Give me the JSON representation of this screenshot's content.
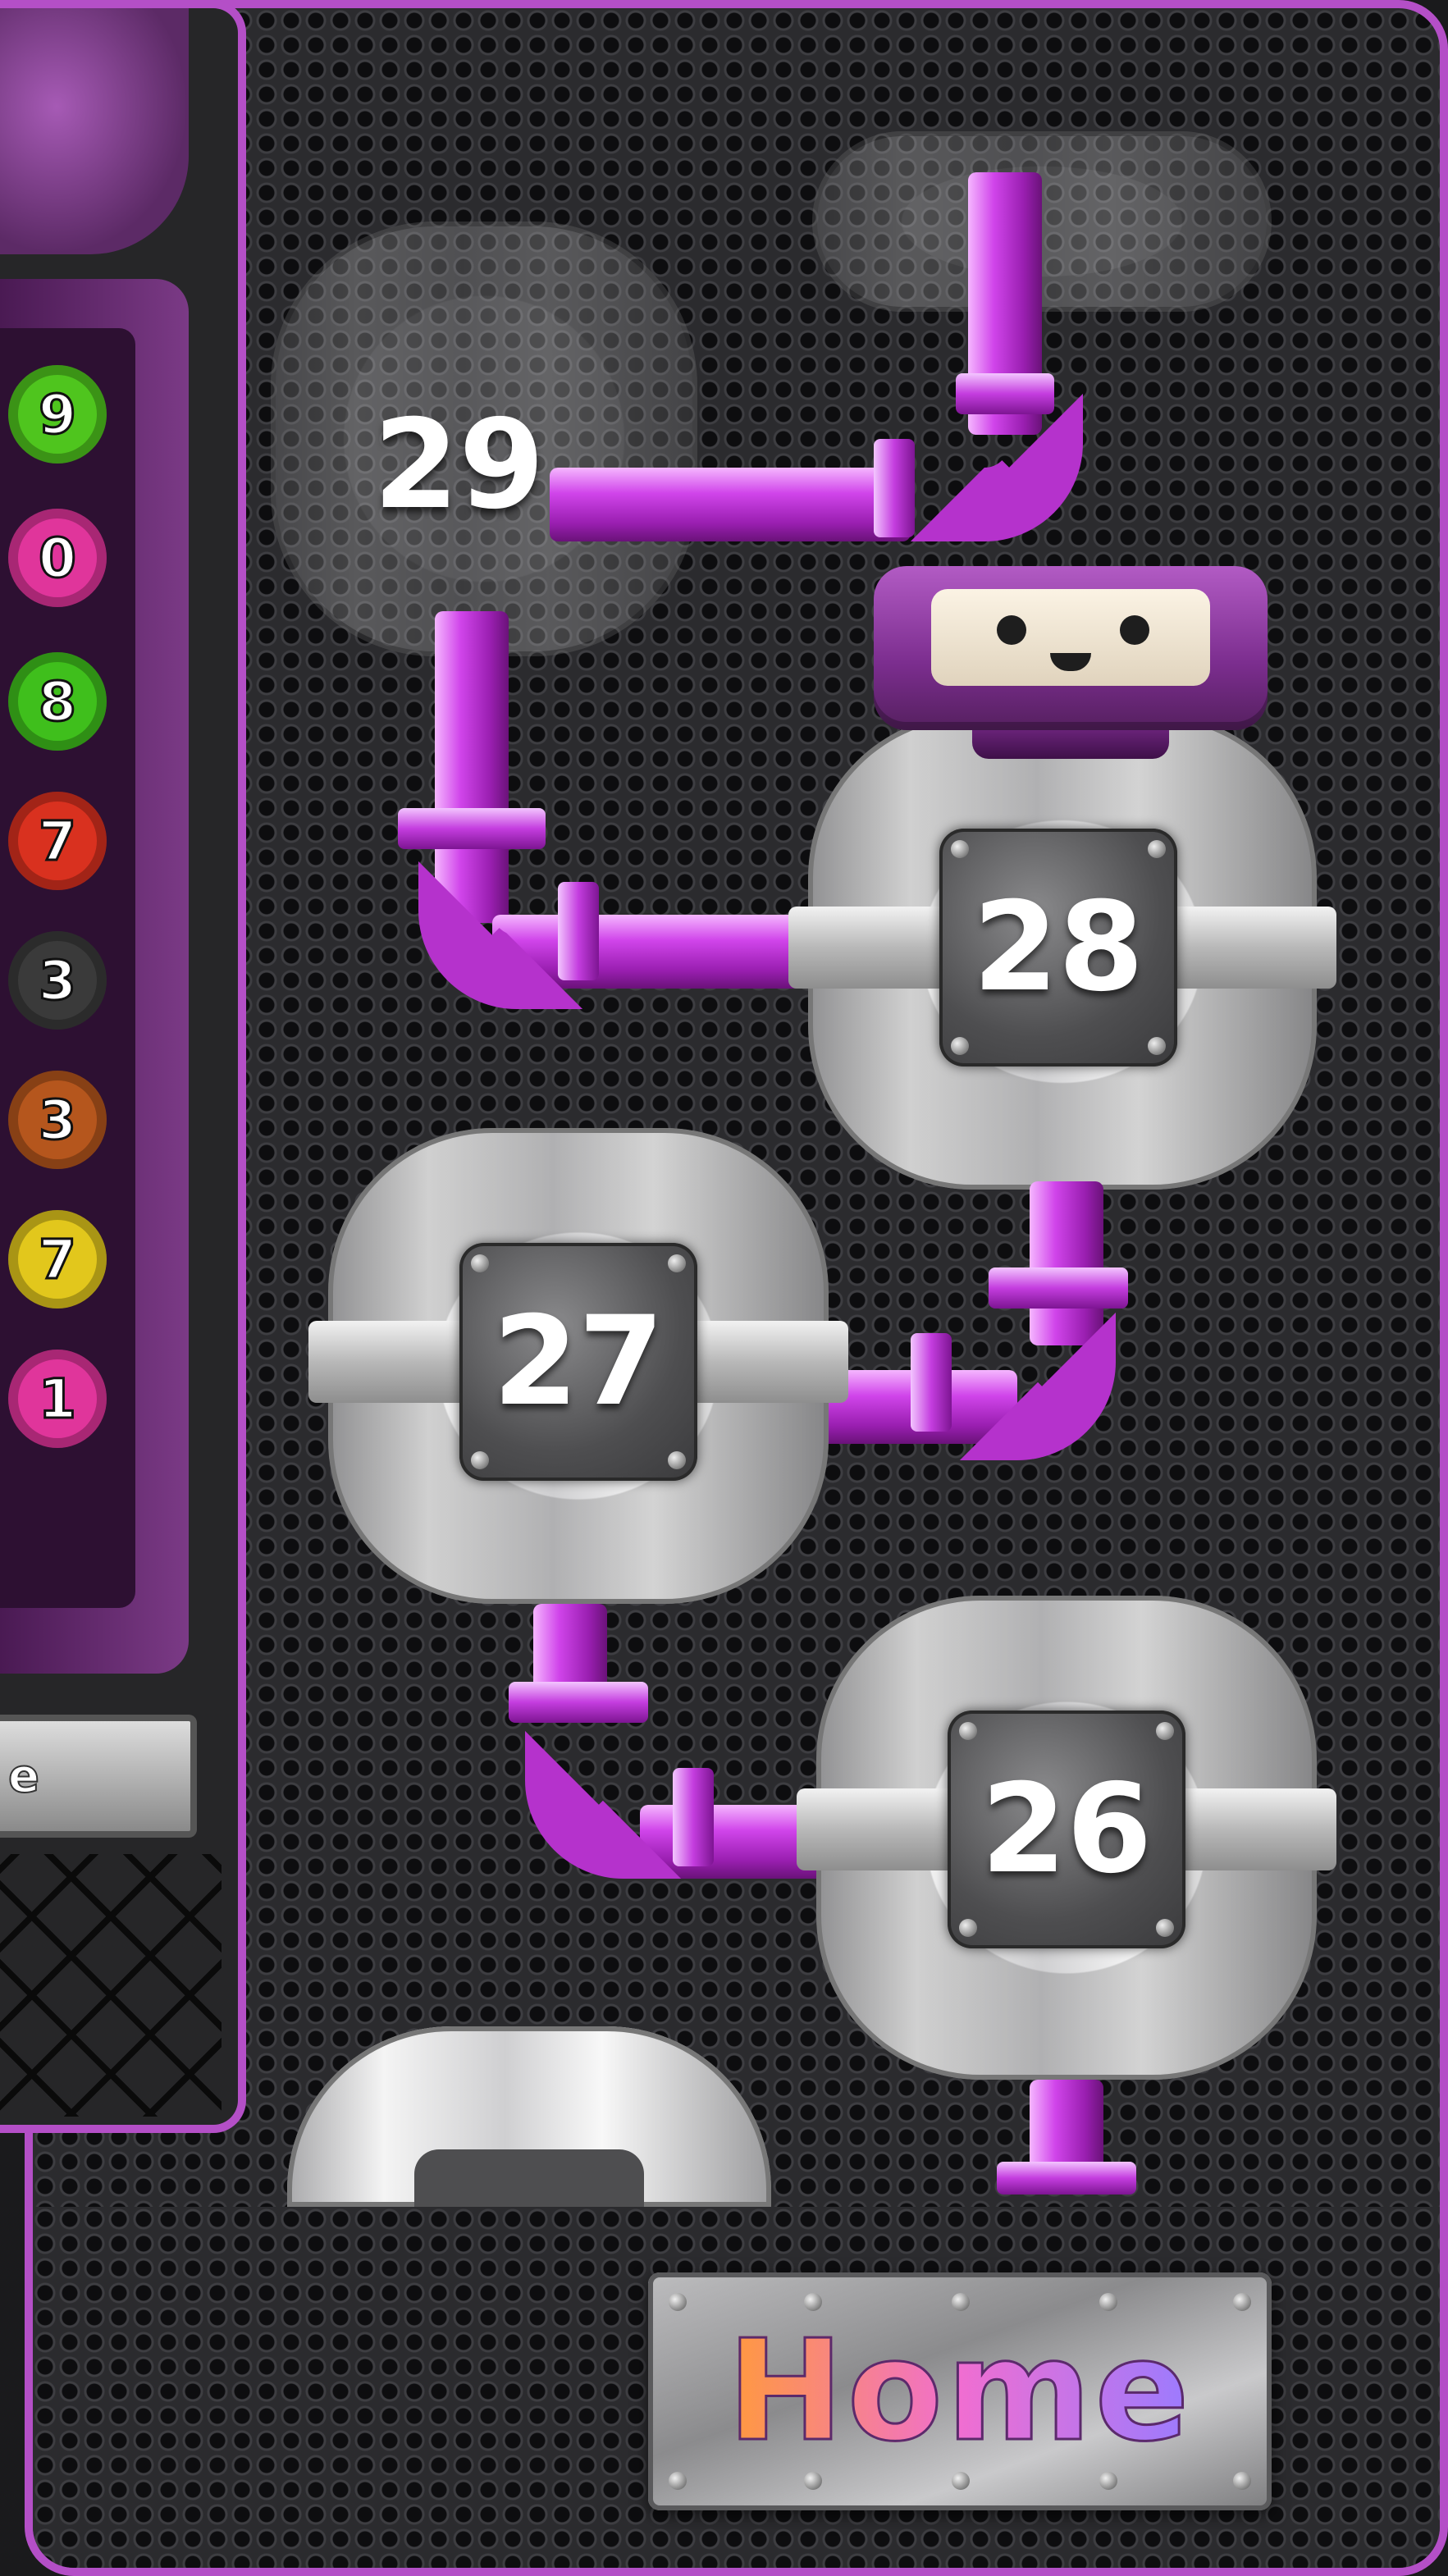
{
  "side_panel": {
    "gears": [
      {
        "label": "9",
        "color": "#4fc51e"
      },
      {
        "label": "0",
        "color": "#e0359b"
      },
      {
        "label": "8",
        "color": "#3fbf1c"
      },
      {
        "label": "7",
        "color": "#d9311f"
      },
      {
        "label": "3",
        "color": "#3a3a3a"
      },
      {
        "label": "3",
        "color": "#b5561d"
      },
      {
        "label": "7",
        "color": "#e2c71c"
      },
      {
        "label": "1",
        "color": "#e0359b"
      }
    ],
    "button_label": "e"
  },
  "levels": [
    {
      "number": "29",
      "state": "locked"
    },
    {
      "number": "28",
      "state": "current"
    },
    {
      "number": "27",
      "state": "unlocked"
    },
    {
      "number": "26",
      "state": "unlocked"
    }
  ],
  "home_button": {
    "label": "Home"
  },
  "colors": {
    "frame_accent": "#b44fc7",
    "pipe_purple": "#d044ea",
    "robot_purple": "#7b2d8e"
  }
}
